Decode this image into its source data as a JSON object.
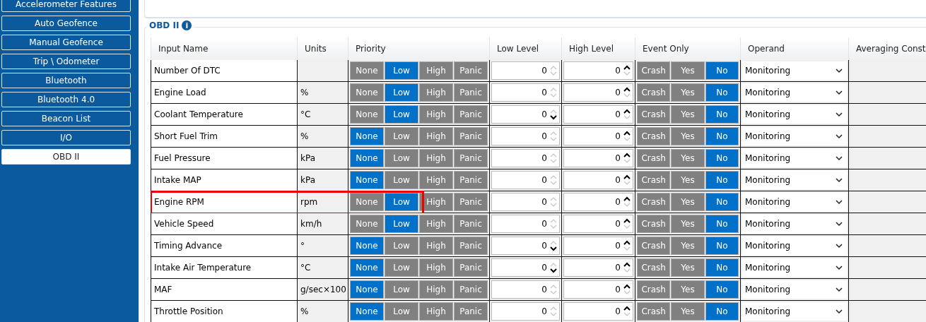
{
  "sidebar": {
    "items": [
      {
        "label": "Accelerometer Features",
        "selected": false
      },
      {
        "label": "Auto Geofence",
        "selected": false
      },
      {
        "label": "Manual Geofence",
        "selected": false
      },
      {
        "label": "Trip \\ Odometer",
        "selected": false
      },
      {
        "label": "Bluetooth",
        "selected": false
      },
      {
        "label": "Bluetooth 4.0",
        "selected": false
      },
      {
        "label": "Beacon List",
        "selected": false
      },
      {
        "label": "I/O",
        "selected": false
      },
      {
        "label": "OBD II",
        "selected": true
      }
    ]
  },
  "group": {
    "title": "OBD II",
    "info_icon": "i"
  },
  "table": {
    "columns": [
      "Input Name",
      "Units",
      "Priority",
      "Low Level",
      "High Level",
      "Event Only",
      "Operand",
      "Averaging Const"
    ],
    "rows": [
      {
        "name": "Number Of DTC",
        "units": "",
        "priority": [
          {
            "label": "None",
            "selected": false
          },
          {
            "label": "Low",
            "selected": true
          },
          {
            "label": "High",
            "selected": false
          },
          {
            "label": "Panic",
            "selected": false
          }
        ],
        "low": {
          "value": "0",
          "up_active": false,
          "down_active": false
        },
        "high": {
          "value": "0",
          "up_active": true,
          "down_active": false
        },
        "event": [
          {
            "label": "Crash",
            "selected": false
          },
          {
            "label": "Yes",
            "selected": false
          },
          {
            "label": "No",
            "selected": true
          }
        ],
        "operand": "Monitoring",
        "highlighted": false
      },
      {
        "name": "Engine Load",
        "units": "%",
        "priority": [
          {
            "label": "None",
            "selected": false
          },
          {
            "label": "Low",
            "selected": true
          },
          {
            "label": "High",
            "selected": false
          },
          {
            "label": "Panic",
            "selected": false
          }
        ],
        "low": {
          "value": "0",
          "up_active": false,
          "down_active": false
        },
        "high": {
          "value": "0",
          "up_active": true,
          "down_active": false
        },
        "event": [
          {
            "label": "Crash",
            "selected": false
          },
          {
            "label": "Yes",
            "selected": false
          },
          {
            "label": "No",
            "selected": true
          }
        ],
        "operand": "Monitoring",
        "highlighted": false
      },
      {
        "name": "Coolant Temperature",
        "units": "°C",
        "priority": [
          {
            "label": "None",
            "selected": false
          },
          {
            "label": "Low",
            "selected": true
          },
          {
            "label": "High",
            "selected": false
          },
          {
            "label": "Panic",
            "selected": false
          }
        ],
        "low": {
          "value": "0",
          "up_active": false,
          "down_active": true
        },
        "high": {
          "value": "0",
          "up_active": true,
          "down_active": false
        },
        "event": [
          {
            "label": "Crash",
            "selected": false
          },
          {
            "label": "Yes",
            "selected": false
          },
          {
            "label": "No",
            "selected": true
          }
        ],
        "operand": "Monitoring",
        "highlighted": false
      },
      {
        "name": "Short Fuel Trim",
        "units": "%",
        "priority": [
          {
            "label": "None",
            "selected": true
          },
          {
            "label": "Low",
            "selected": false
          },
          {
            "label": "High",
            "selected": false
          },
          {
            "label": "Panic",
            "selected": false
          }
        ],
        "low": {
          "value": "0",
          "up_active": false,
          "down_active": false
        },
        "high": {
          "value": "0",
          "up_active": true,
          "down_active": false
        },
        "event": [
          {
            "label": "Crash",
            "selected": false
          },
          {
            "label": "Yes",
            "selected": false
          },
          {
            "label": "No",
            "selected": true
          }
        ],
        "operand": "Monitoring",
        "highlighted": false
      },
      {
        "name": "Fuel Pressure",
        "units": "kPa",
        "priority": [
          {
            "label": "None",
            "selected": true
          },
          {
            "label": "Low",
            "selected": false
          },
          {
            "label": "High",
            "selected": false
          },
          {
            "label": "Panic",
            "selected": false
          }
        ],
        "low": {
          "value": "0",
          "up_active": false,
          "down_active": false
        },
        "high": {
          "value": "0",
          "up_active": true,
          "down_active": false
        },
        "event": [
          {
            "label": "Crash",
            "selected": false
          },
          {
            "label": "Yes",
            "selected": false
          },
          {
            "label": "No",
            "selected": true
          }
        ],
        "operand": "Monitoring",
        "highlighted": false
      },
      {
        "name": "Intake MAP",
        "units": "kPa",
        "priority": [
          {
            "label": "None",
            "selected": true
          },
          {
            "label": "Low",
            "selected": false
          },
          {
            "label": "High",
            "selected": false
          },
          {
            "label": "Panic",
            "selected": false
          }
        ],
        "low": {
          "value": "0",
          "up_active": false,
          "down_active": false
        },
        "high": {
          "value": "0",
          "up_active": true,
          "down_active": false
        },
        "event": [
          {
            "label": "Crash",
            "selected": false
          },
          {
            "label": "Yes",
            "selected": false
          },
          {
            "label": "No",
            "selected": true
          }
        ],
        "operand": "Monitoring",
        "highlighted": false
      },
      {
        "name": "Engine RPM",
        "units": "rpm",
        "priority": [
          {
            "label": "None",
            "selected": false
          },
          {
            "label": "Low",
            "selected": true
          },
          {
            "label": "High",
            "selected": false
          },
          {
            "label": "Panic",
            "selected": false
          }
        ],
        "low": {
          "value": "0",
          "up_active": false,
          "down_active": false
        },
        "high": {
          "value": "0",
          "up_active": true,
          "down_active": false
        },
        "event": [
          {
            "label": "Crash",
            "selected": false
          },
          {
            "label": "Yes",
            "selected": false
          },
          {
            "label": "No",
            "selected": true
          }
        ],
        "operand": "Monitoring",
        "highlighted": true
      },
      {
        "name": "Vehicle Speed",
        "units": "km/h",
        "priority": [
          {
            "label": "None",
            "selected": false
          },
          {
            "label": "Low",
            "selected": true
          },
          {
            "label": "High",
            "selected": false
          },
          {
            "label": "Panic",
            "selected": false
          }
        ],
        "low": {
          "value": "0",
          "up_active": false,
          "down_active": false
        },
        "high": {
          "value": "0",
          "up_active": true,
          "down_active": false
        },
        "event": [
          {
            "label": "Crash",
            "selected": false
          },
          {
            "label": "Yes",
            "selected": false
          },
          {
            "label": "No",
            "selected": true
          }
        ],
        "operand": "Monitoring",
        "highlighted": false
      },
      {
        "name": "Timing Advance",
        "units": "°",
        "priority": [
          {
            "label": "None",
            "selected": true
          },
          {
            "label": "Low",
            "selected": false
          },
          {
            "label": "High",
            "selected": false
          },
          {
            "label": "Panic",
            "selected": false
          }
        ],
        "low": {
          "value": "0",
          "up_active": false,
          "down_active": true
        },
        "high": {
          "value": "0",
          "up_active": true,
          "down_active": false
        },
        "event": [
          {
            "label": "Crash",
            "selected": false
          },
          {
            "label": "Yes",
            "selected": false
          },
          {
            "label": "No",
            "selected": true
          }
        ],
        "operand": "Monitoring",
        "highlighted": false
      },
      {
        "name": "Intake Air Temperature",
        "units": "°C",
        "priority": [
          {
            "label": "None",
            "selected": true
          },
          {
            "label": "Low",
            "selected": false
          },
          {
            "label": "High",
            "selected": false
          },
          {
            "label": "Panic",
            "selected": false
          }
        ],
        "low": {
          "value": "0",
          "up_active": false,
          "down_active": true
        },
        "high": {
          "value": "0",
          "up_active": true,
          "down_active": false
        },
        "event": [
          {
            "label": "Crash",
            "selected": false
          },
          {
            "label": "Yes",
            "selected": false
          },
          {
            "label": "No",
            "selected": true
          }
        ],
        "operand": "Monitoring",
        "highlighted": false
      },
      {
        "name": "MAF",
        "units": "g/sec×100",
        "priority": [
          {
            "label": "None",
            "selected": true
          },
          {
            "label": "Low",
            "selected": false
          },
          {
            "label": "High",
            "selected": false
          },
          {
            "label": "Panic",
            "selected": false
          }
        ],
        "low": {
          "value": "0",
          "up_active": false,
          "down_active": false
        },
        "high": {
          "value": "0",
          "up_active": true,
          "down_active": false
        },
        "event": [
          {
            "label": "Crash",
            "selected": false
          },
          {
            "label": "Yes",
            "selected": false
          },
          {
            "label": "No",
            "selected": true
          }
        ],
        "operand": "Monitoring",
        "highlighted": false
      },
      {
        "name": "Throttle Position",
        "units": "%",
        "priority": [
          {
            "label": "None",
            "selected": true
          },
          {
            "label": "Low",
            "selected": false
          },
          {
            "label": "High",
            "selected": false
          },
          {
            "label": "Panic",
            "selected": false
          }
        ],
        "low": {
          "value": "0",
          "up_active": false,
          "down_active": false
        },
        "high": {
          "value": "0",
          "up_active": true,
          "down_active": false
        },
        "event": [
          {
            "label": "Crash",
            "selected": false
          },
          {
            "label": "Yes",
            "selected": false
          },
          {
            "label": "No",
            "selected": true
          }
        ],
        "operand": "Monitoring",
        "highlighted": false
      }
    ]
  }
}
